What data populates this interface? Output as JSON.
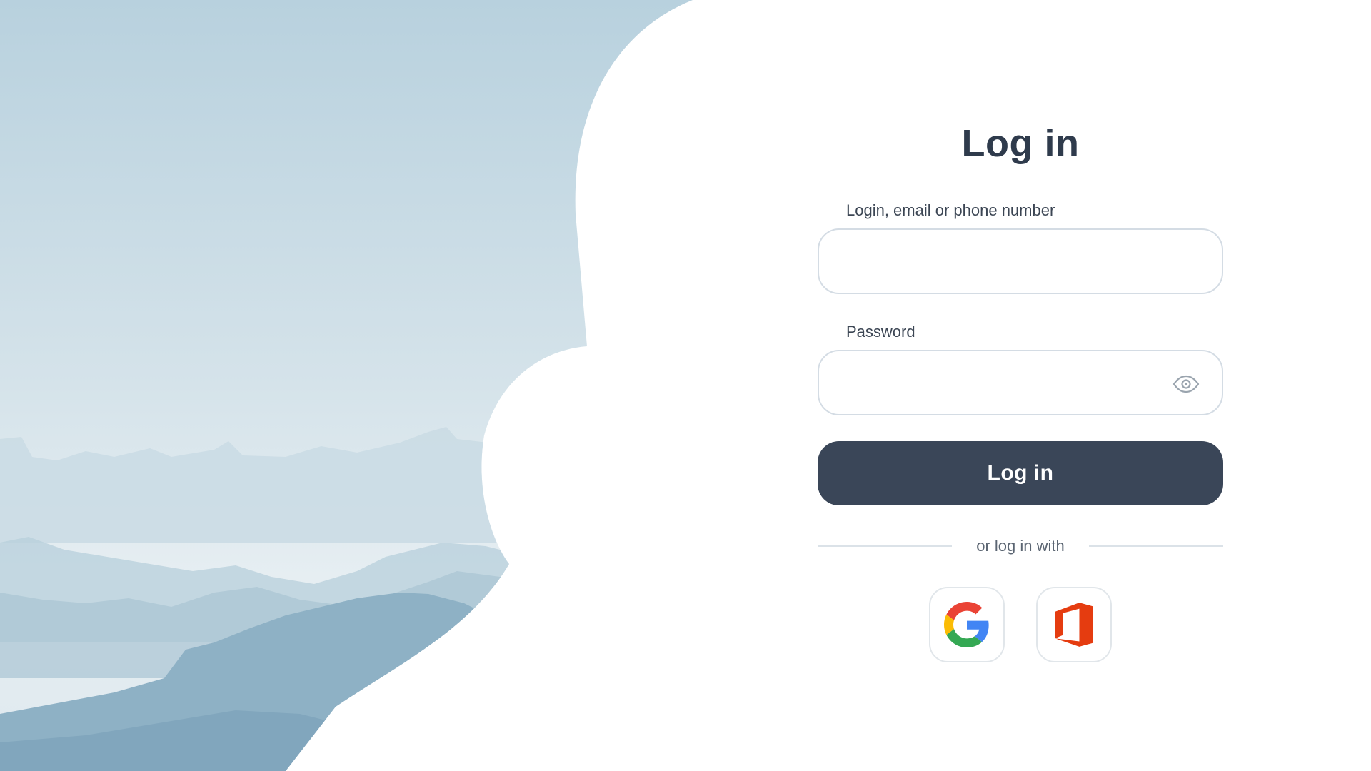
{
  "login": {
    "title": "Log in",
    "login_label": "Login, email or phone number",
    "login_value": "",
    "login_placeholder": "",
    "password_label": "Password",
    "password_value": "",
    "password_placeholder": "",
    "submit_label": "Log in",
    "alt_login_text": "or log in with",
    "social_providers": [
      {
        "name": "google-icon"
      },
      {
        "name": "microsoft-office-icon"
      }
    ]
  },
  "colors": {
    "primary_button": "#3a4658",
    "title_text": "#2f3b4c",
    "sky_top": "#b9d3df",
    "mountains": "#8fb2c7",
    "office_red": "#e53c10",
    "google_blue": "#4285F4",
    "google_red": "#EA4335",
    "google_yellow": "#FBBC05",
    "google_green": "#34A853"
  }
}
